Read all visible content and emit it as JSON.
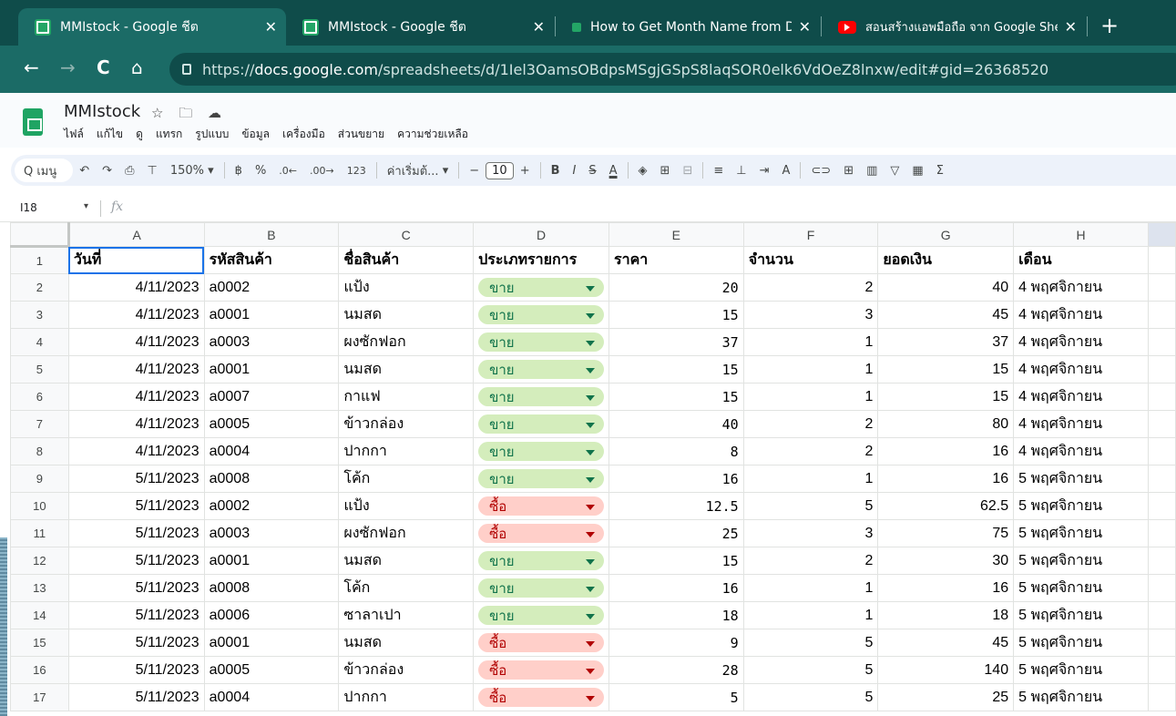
{
  "tabs": [
    {
      "title": "MMIstock - Google ชีต",
      "icon": "sheets-icon",
      "close": "✕"
    },
    {
      "title": "MMIstock - Google ชีต",
      "icon": "sheets-icon",
      "close": "✕"
    },
    {
      "title": "How to Get Month Name from Date",
      "icon": "sheets-icon",
      "close": "✕"
    },
    {
      "title": "สอนสร้างแอพมือถือ จาก Google Sheets",
      "icon": "youtube-icon",
      "close": "✕"
    }
  ],
  "new_tab": "+",
  "nav": {
    "back": "←",
    "forward": "→",
    "reload": "C",
    "home": "⌂"
  },
  "url": {
    "scheme": "https://",
    "host": "docs.google.com",
    "path": "/spreadsheets/d/1Iel3OamsOBdpsMSgjGSpS8laqSOR0elk6VdOeZ8lnxw/edit#gid=26368520"
  },
  "doc": {
    "title": "MMIstock",
    "title_icons": "☆ 🗀 ☁",
    "menu": [
      "ไฟล์",
      "แก้ไข",
      "ดู",
      "แทรก",
      "รูปแบบ",
      "ข้อมูล",
      "เครื่องมือ",
      "ส่วนขยาย",
      "ความช่วยเหลือ"
    ]
  },
  "toolbar": {
    "search": "Q เมนู",
    "undo": "↶",
    "redo": "↷",
    "print": "⎙",
    "paint": "⊤",
    "zoom": "150%",
    "zoom_drop": "▾",
    "currency": "฿",
    "percent": "%",
    "dec_less": ".0←",
    "dec_more": ".00→",
    "format": "123",
    "font": "ค่าเริ่มต้...",
    "font_drop": "▾",
    "minus": "−",
    "font_size": "10",
    "plus": "+",
    "bold": "B",
    "italic": "I",
    "strike": "S",
    "textcolor": "A",
    "fill": "◈",
    "borders": "⊞",
    "merge": "⊟",
    "halign": "≡",
    "valign": "⊥",
    "wrap": "⇥",
    "rotate": "A",
    "link": "⊂⊃",
    "comment": "⊞",
    "chart": "▥",
    "filter": "▽",
    "views": "▦",
    "functions": "Σ"
  },
  "formula_bar": {
    "cell_ref": "I18",
    "drop": "▾",
    "fx": "fx"
  },
  "grid": {
    "columns": [
      "A",
      "B",
      "C",
      "D",
      "E",
      "F",
      "G",
      "H"
    ],
    "headers": [
      "วันที่",
      "รหัสสินค้า",
      "ชื่อสินค้า",
      "ประเภทรายการ",
      "ราคา",
      "จำนวน",
      "ยอดเงิน",
      "เดือน"
    ],
    "rows": [
      {
        "n": "2",
        "date": "4/11/2023",
        "code": "a0002",
        "name": "แป้ง",
        "type": "ขาย",
        "kind": "sell",
        "price": "20",
        "qty": "2",
        "total": "40",
        "month": "4 พฤศจิกายน"
      },
      {
        "n": "3",
        "date": "4/11/2023",
        "code": "a0001",
        "name": "นมสด",
        "type": "ขาย",
        "kind": "sell",
        "price": "15",
        "qty": "3",
        "total": "45",
        "month": "4 พฤศจิกายน"
      },
      {
        "n": "4",
        "date": "4/11/2023",
        "code": "a0003",
        "name": "ผงซักฟอก",
        "type": "ขาย",
        "kind": "sell",
        "price": "37",
        "qty": "1",
        "total": "37",
        "month": "4 พฤศจิกายน"
      },
      {
        "n": "5",
        "date": "4/11/2023",
        "code": "a0001",
        "name": "นมสด",
        "type": "ขาย",
        "kind": "sell",
        "price": "15",
        "qty": "1",
        "total": "15",
        "month": "4 พฤศจิกายน"
      },
      {
        "n": "6",
        "date": "4/11/2023",
        "code": "a0007",
        "name": "กาแฟ",
        "type": "ขาย",
        "kind": "sell",
        "price": "15",
        "qty": "1",
        "total": "15",
        "month": "4 พฤศจิกายน"
      },
      {
        "n": "7",
        "date": "4/11/2023",
        "code": "a0005",
        "name": "ข้าวกล่อง",
        "type": "ขาย",
        "kind": "sell",
        "price": "40",
        "qty": "2",
        "total": "80",
        "month": "4 พฤศจิกายน"
      },
      {
        "n": "8",
        "date": "4/11/2023",
        "code": "a0004",
        "name": "ปากกา",
        "type": "ขาย",
        "kind": "sell",
        "price": "8",
        "qty": "2",
        "total": "16",
        "month": "4 พฤศจิกายน"
      },
      {
        "n": "9",
        "date": "5/11/2023",
        "code": "a0008",
        "name": "โค้ก",
        "type": "ขาย",
        "kind": "sell",
        "price": "16",
        "qty": "1",
        "total": "16",
        "month": "5 พฤศจิกายน"
      },
      {
        "n": "10",
        "date": "5/11/2023",
        "code": "a0002",
        "name": "แป้ง",
        "type": "ซื้อ",
        "kind": "buy",
        "price": "12.5",
        "qty": "5",
        "total": "62.5",
        "month": "5 พฤศจิกายน"
      },
      {
        "n": "11",
        "date": "5/11/2023",
        "code": "a0003",
        "name": "ผงซักฟอก",
        "type": "ซื้อ",
        "kind": "buy",
        "price": "25",
        "qty": "3",
        "total": "75",
        "month": "5 พฤศจิกายน"
      },
      {
        "n": "12",
        "date": "5/11/2023",
        "code": "a0001",
        "name": "นมสด",
        "type": "ขาย",
        "kind": "sell",
        "price": "15",
        "qty": "2",
        "total": "30",
        "month": "5 พฤศจิกายน"
      },
      {
        "n": "13",
        "date": "5/11/2023",
        "code": "a0008",
        "name": "โค้ก",
        "type": "ขาย",
        "kind": "sell",
        "price": "16",
        "qty": "1",
        "total": "16",
        "month": "5 พฤศจิกายน"
      },
      {
        "n": "14",
        "date": "5/11/2023",
        "code": "a0006",
        "name": "ซาลาเปา",
        "type": "ขาย",
        "kind": "sell",
        "price": "18",
        "qty": "1",
        "total": "18",
        "month": "5 พฤศจิกายน"
      },
      {
        "n": "15",
        "date": "5/11/2023",
        "code": "a0001",
        "name": "นมสด",
        "type": "ซื้อ",
        "kind": "buy",
        "price": "9",
        "qty": "5",
        "total": "45",
        "month": "5 พฤศจิกายน"
      },
      {
        "n": "16",
        "date": "5/11/2023",
        "code": "a0005",
        "name": "ข้าวกล่อง",
        "type": "ซื้อ",
        "kind": "buy",
        "price": "28",
        "qty": "5",
        "total": "140",
        "month": "5 พฤศจิกายน"
      },
      {
        "n": "17",
        "date": "5/11/2023",
        "code": "a0004",
        "name": "ปากกา",
        "type": "ซื้อ",
        "kind": "buy",
        "price": "5",
        "qty": "5",
        "total": "25",
        "month": "5 พฤศจิกายน"
      }
    ]
  },
  "colors": {
    "tab_bg": "#0f4c4a",
    "address_bg": "#1b6b66",
    "sell_chip": "#d4edbc",
    "buy_chip": "#ffcfc9",
    "selection": "#1a73e8"
  }
}
